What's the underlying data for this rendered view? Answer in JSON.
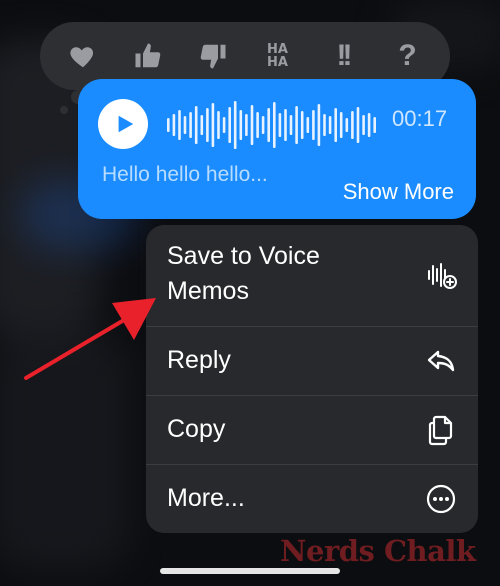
{
  "tapbacks": {
    "haha_top": "HA",
    "haha_bottom": "HA",
    "emphasize": "!!",
    "question": "?"
  },
  "message": {
    "duration": "00:17",
    "transcript": "Hello hello hello...",
    "show_more": "Show More"
  },
  "menu": {
    "save_line1": "Save to Voice",
    "save_line2": "Memos",
    "reply": "Reply",
    "copy": "Copy",
    "more": "More..."
  },
  "watermark": "Nerds Chalk",
  "colors": {
    "bubble": "#1a8cff",
    "menu_bg": "#28292d",
    "tapback_bg": "#2e2f33",
    "arrow": "#e8212b"
  }
}
